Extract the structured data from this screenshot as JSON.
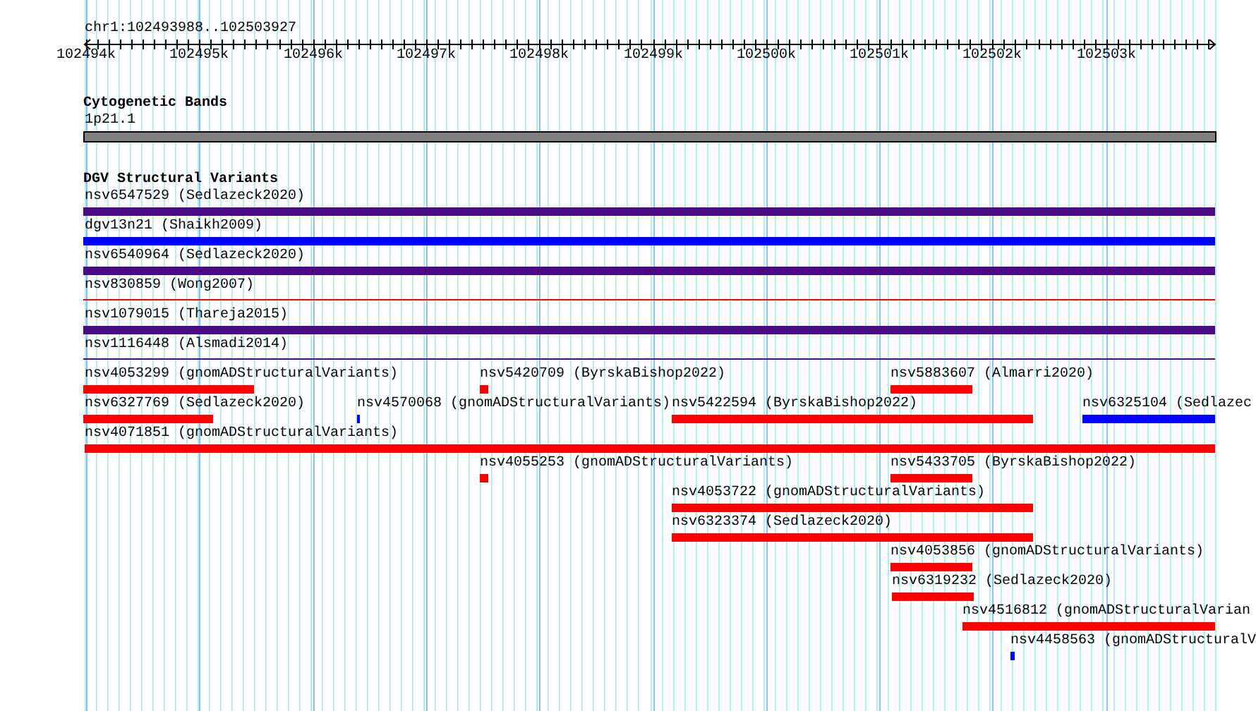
{
  "ruler": {
    "region": "chr1:102493988..102503927",
    "ticks": [
      "102494k",
      "102495k",
      "102496k",
      "102497k",
      "102498k",
      "102499k",
      "102500k",
      "102501k",
      "102502k",
      "102503k"
    ]
  },
  "cytogenetic_bands": {
    "title": "Cytogenetic Bands",
    "band": "1p21.1"
  },
  "dgv_structural_variants": {
    "title": "DGV Structural Variants",
    "rows": [
      {
        "features": [
          {
            "label": "nsv6547529 (Sedlazeck2020)",
            "color": "#4b0a85",
            "kind": "bar"
          }
        ]
      },
      {
        "features": [
          {
            "label": "dgv13n21 (Shaikh2009)",
            "color": "#0000ff",
            "kind": "bar"
          }
        ]
      },
      {
        "features": [
          {
            "label": "nsv6540964 (Sedlazeck2020)",
            "color": "#4b0a85",
            "kind": "bar"
          }
        ]
      },
      {
        "features": [
          {
            "label": "nsv830859 (Wong2007)",
            "color": "#ff0000",
            "kind": "line"
          }
        ]
      },
      {
        "features": [
          {
            "label": "nsv1079015 (Thareja2015)",
            "color": "#4b0a85",
            "kind": "bar"
          }
        ]
      },
      {
        "features": [
          {
            "label": "nsv1116448 (Alsmadi2014)",
            "color": "#4b0a85",
            "kind": "line"
          }
        ]
      },
      {
        "features": [
          {
            "label": "nsv4053299 (gnomADStructuralVariants)",
            "color": "#ff0000",
            "kind": "bar"
          },
          {
            "label": "nsv5420709 (ByrskaBishop2022)",
            "color": "#ff0000",
            "kind": "bar"
          },
          {
            "label": "nsv5883607 (Almarri2020)",
            "color": "#ff0000",
            "kind": "bar"
          }
        ]
      },
      {
        "features": [
          {
            "label": "nsv6327769 (Sedlazeck2020)",
            "color": "#ff0000",
            "kind": "bar"
          },
          {
            "label": "nsv4570068 (gnomADStructuralVariants)",
            "color": "#0000ff",
            "kind": "bar"
          },
          {
            "label": "nsv5422594 (ByrskaBishop2022)",
            "color": "#ff0000",
            "kind": "bar"
          },
          {
            "label": "nsv6325104 (Sedlazec",
            "color": "#0000ff",
            "kind": "bar"
          }
        ]
      },
      {
        "features": [
          {
            "label": "nsv4071851 (gnomADStructuralVariants)",
            "color": "#ff0000",
            "kind": "bar"
          }
        ]
      },
      {
        "features": [
          {
            "label": "nsv4055253 (gnomADStructuralVariants)",
            "color": "#ff0000",
            "kind": "bar"
          },
          {
            "label": "nsv5433705 (ByrskaBishop2022)",
            "color": "#ff0000",
            "kind": "bar"
          }
        ]
      },
      {
        "features": [
          {
            "label": "nsv4053722 (gnomADStructuralVariants)",
            "color": "#ff0000",
            "kind": "bar"
          }
        ]
      },
      {
        "features": [
          {
            "label": "nsv6323374 (Sedlazeck2020)",
            "color": "#ff0000",
            "kind": "bar"
          }
        ]
      },
      {
        "features": [
          {
            "label": "nsv4053856 (gnomADStructuralVariants)",
            "color": "#ff0000",
            "kind": "bar"
          }
        ]
      },
      {
        "features": [
          {
            "label": "nsv6319232 (Sedlazeck2020)",
            "color": "#ff0000",
            "kind": "bar"
          }
        ]
      },
      {
        "features": [
          {
            "label": "nsv4516812 (gnomADStructuralVarian",
            "color": "#ff0000",
            "kind": "bar"
          }
        ]
      },
      {
        "features": [
          {
            "label": "nsv4458563 (gnomADStructuralV",
            "color": "#0000ff",
            "kind": "bar"
          }
        ]
      }
    ]
  }
}
